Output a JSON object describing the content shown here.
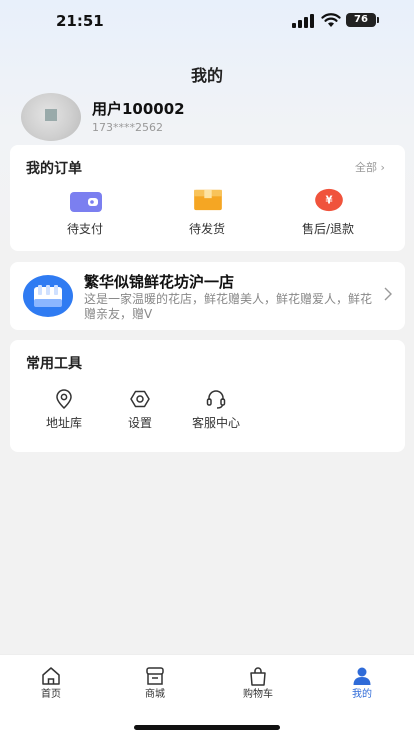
{
  "status": {
    "time": "21:51",
    "battery": "76"
  },
  "header": {
    "title": "我的"
  },
  "profile": {
    "name": "用户100002",
    "phone": "173****2562"
  },
  "orders": {
    "title": "我的订单",
    "all_label": "全部",
    "items": [
      {
        "label": "待支付",
        "icon": "wallet-icon"
      },
      {
        "label": "待发货",
        "icon": "box-icon"
      },
      {
        "label": "售后/退款",
        "icon": "refund-icon"
      }
    ]
  },
  "shop": {
    "name": "繁华似锦鲜花坊沪一店",
    "description": "这是一家温暖的花店，鲜花赠美人，鲜花赠爱人，鲜花赠亲友，赠V"
  },
  "tools": {
    "title": "常用工具",
    "items": [
      {
        "label": "地址库",
        "icon": "location-icon"
      },
      {
        "label": "设置",
        "icon": "gear-icon"
      },
      {
        "label": "客服中心",
        "icon": "headset-icon"
      }
    ]
  },
  "tabbar": {
    "items": [
      {
        "label": "首页",
        "icon": "home-icon",
        "active": false
      },
      {
        "label": "商城",
        "icon": "store-icon",
        "active": false
      },
      {
        "label": "购物车",
        "icon": "bag-icon",
        "active": false
      },
      {
        "label": "我的",
        "icon": "user-icon",
        "active": true
      }
    ]
  },
  "colors": {
    "accent": "#2f6bd8",
    "orange": "#f5a623",
    "red": "#f0533c",
    "purple": "#7b7ff0"
  }
}
